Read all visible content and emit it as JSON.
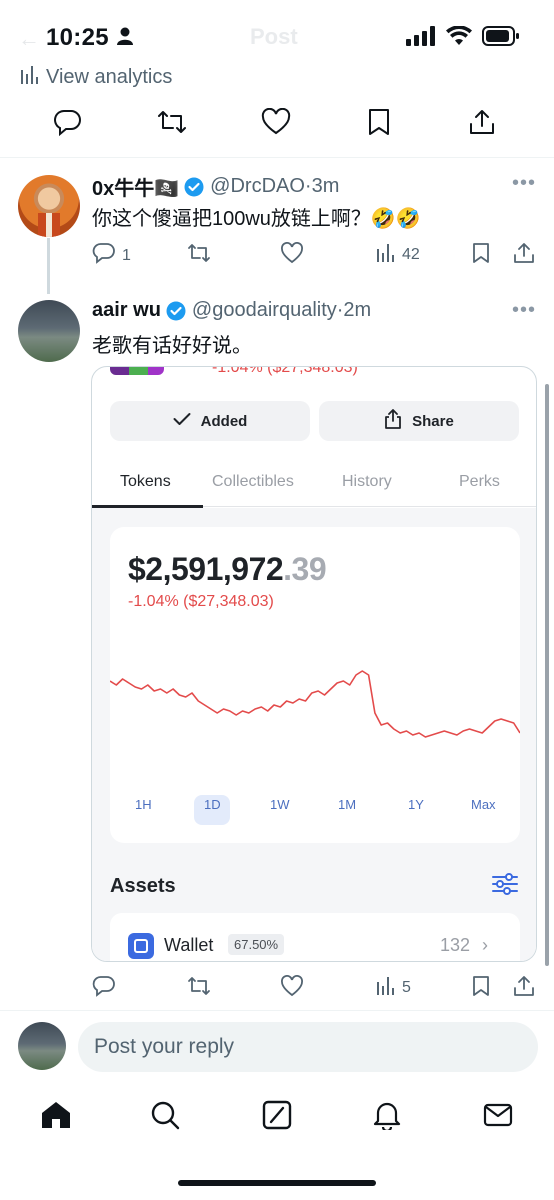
{
  "status_bar": {
    "time": "10:25",
    "ghost_title": "Post",
    "ghost_back": "←"
  },
  "analytics": {
    "label": "View analytics"
  },
  "tweets": [
    {
      "name": "0x牛牛🏴‍☠️",
      "handle": "@DrcDAO",
      "time": "·3m",
      "text": "你这个傻逼把100wu放链上啊？🤣🤣",
      "replies": "1",
      "views": "42"
    },
    {
      "name": "aair wu",
      "handle": "@goodairquality",
      "time": "·2m",
      "text": "老歌有话好好说。",
      "views": "5"
    }
  ],
  "more_label": "•••",
  "embed": {
    "cut_text": "-1.04% ($27,348.03)",
    "added_label": "Added",
    "share_label": "Share",
    "tabs": [
      "Tokens",
      "Collectibles",
      "History",
      "Perks"
    ],
    "balance_main": "$2,591,972",
    "balance_cents": ".39",
    "change": "-1.04% ($27,348.03)",
    "ranges": [
      "1H",
      "1D",
      "1W",
      "1M",
      "1Y",
      "Max"
    ],
    "assets_title": "Assets",
    "wallet_label": "Wallet",
    "wallet_pct": "67.50%",
    "wallet_count": "132",
    "wallet_chevron": "›"
  },
  "chart_data": {
    "type": "line",
    "title": "",
    "xlabel": "",
    "ylabel": "",
    "series": [
      {
        "values": [
          76,
          74,
          77,
          75,
          73,
          72,
          74,
          71,
          72,
          70,
          72,
          69,
          68,
          70,
          66,
          64,
          62,
          60,
          62,
          61,
          59,
          61,
          60,
          62,
          63,
          61,
          64,
          63,
          66,
          65,
          67,
          66,
          70,
          71,
          69,
          72,
          75,
          76,
          74,
          79,
          81,
          79,
          60,
          54,
          55,
          52,
          50,
          51,
          49,
          50,
          48,
          49,
          50,
          51,
          50,
          49,
          51,
          52,
          51,
          50,
          53,
          56,
          57,
          56,
          55,
          50
        ]
      }
    ],
    "ylim": [
      40,
      90
    ],
    "color": "#e34b4b"
  },
  "reply": {
    "placeholder": "Post your reply"
  },
  "colors": {
    "verified": "#1d9bf0",
    "link_blue": "#4c6fbf",
    "negative": "#e34b4b"
  }
}
